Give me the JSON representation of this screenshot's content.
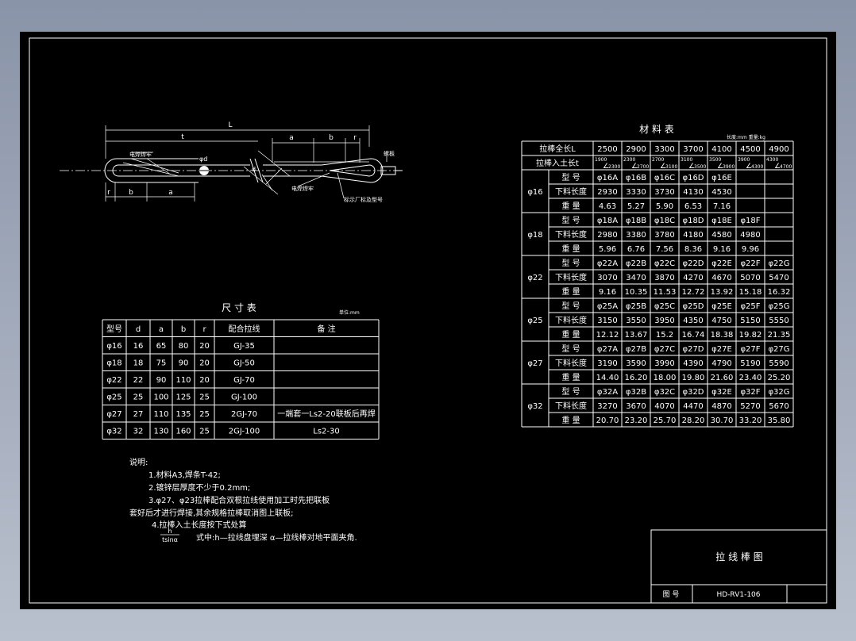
{
  "drawing": {
    "labels": {
      "L": "L",
      "t": "t",
      "a": "a",
      "b": "b",
      "r": "r",
      "weld_left": "电焊焊牢",
      "weld_right": "电焊焊牢",
      "mark": "标示厂标及型号",
      "bolt": "螺板",
      "d": "d",
      "phi": "φd"
    }
  },
  "dim_table": {
    "title": "尺 寸 表",
    "unit": "单位:mm",
    "headers": [
      "型号",
      "d",
      "a",
      "b",
      "r",
      "配合拉线",
      "备        注"
    ],
    "rows": [
      [
        "φ16",
        "16",
        "65",
        "80",
        "20",
        "GJ-35",
        ""
      ],
      [
        "φ18",
        "18",
        "75",
        "90",
        "20",
        "GJ-50",
        ""
      ],
      [
        "φ22",
        "22",
        "90",
        "110",
        "20",
        "GJ-70",
        ""
      ],
      [
        "φ25",
        "25",
        "100",
        "125",
        "25",
        "GJ-100",
        ""
      ],
      [
        "φ27",
        "27",
        "110",
        "135",
        "25",
        "2GJ-70",
        "一端套一Ls2-20联板后再焊"
      ],
      [
        "φ32",
        "32",
        "130",
        "160",
        "25",
        "2GJ-100",
        "Ls2-30"
      ]
    ]
  },
  "material_table": {
    "title": "材 料 表",
    "unit": "长度:mm   重量:kg",
    "total_length_label": "拉棒全长L",
    "total_lengths": [
      "2500",
      "2900",
      "3300",
      "3700",
      "4100",
      "4500",
      "4900"
    ],
    "buried_label": "拉棒入土长t",
    "buried": [
      {
        "top": "1900",
        "bottom": "2300"
      },
      {
        "top": "2300",
        "bottom": "2700"
      },
      {
        "top": "2700",
        "bottom": "3100"
      },
      {
        "top": "3100",
        "bottom": "3500"
      },
      {
        "top": "3500",
        "bottom": "3900"
      },
      {
        "top": "3900",
        "bottom": "4300"
      },
      {
        "top": "4300",
        "bottom": "4700"
      }
    ],
    "row_labels": [
      "型  号",
      "下料长度",
      "重  量"
    ],
    "groups": [
      {
        "name": "φ16",
        "models": [
          "φ16A",
          "φ16B",
          "φ16C",
          "φ16D",
          "φ16E",
          "",
          ""
        ],
        "lengths": [
          "2930",
          "3330",
          "3730",
          "4130",
          "4530",
          "",
          ""
        ],
        "weights": [
          "4.63",
          "5.27",
          "5.90",
          "6.53",
          "7.16",
          "",
          ""
        ]
      },
      {
        "name": "φ18",
        "models": [
          "φ18A",
          "φ18B",
          "φ18C",
          "φ18D",
          "φ18E",
          "φ18F",
          ""
        ],
        "lengths": [
          "2980",
          "3380",
          "3780",
          "4180",
          "4580",
          "4980",
          ""
        ],
        "weights": [
          "5.96",
          "6.76",
          "7.56",
          "8.36",
          "9.16",
          "9.96",
          ""
        ]
      },
      {
        "name": "φ22",
        "models": [
          "φ22A",
          "φ22B",
          "φ22C",
          "φ22D",
          "φ22E",
          "φ22F",
          "φ22G"
        ],
        "lengths": [
          "3070",
          "3470",
          "3870",
          "4270",
          "4670",
          "5070",
          "5470"
        ],
        "weights": [
          "9.16",
          "10.35",
          "11.53",
          "12.72",
          "13.92",
          "15.18",
          "16.32"
        ]
      },
      {
        "name": "φ25",
        "models": [
          "φ25A",
          "φ25B",
          "φ25C",
          "φ25D",
          "φ25E",
          "φ25F",
          "φ25G"
        ],
        "lengths": [
          "3150",
          "3550",
          "3950",
          "4350",
          "4750",
          "5150",
          "5550"
        ],
        "weights": [
          "12.12",
          "13.67",
          "15.2",
          "16.74",
          "18.38",
          "19.82",
          "21.35"
        ]
      },
      {
        "name": "φ27",
        "models": [
          "φ27A",
          "φ27B",
          "φ27C",
          "φ27D",
          "φ27E",
          "φ27F",
          "φ27G"
        ],
        "lengths": [
          "3190",
          "3590",
          "3990",
          "4390",
          "4790",
          "5190",
          "5590"
        ],
        "weights": [
          "14.40",
          "16.20",
          "18.00",
          "19.80",
          "21.60",
          "23.40",
          "25.20"
        ]
      },
      {
        "name": "φ32",
        "models": [
          "φ32A",
          "φ32B",
          "φ32C",
          "φ32D",
          "φ32E",
          "φ32F",
          "φ32G"
        ],
        "lengths": [
          "3270",
          "3670",
          "4070",
          "4470",
          "4870",
          "5270",
          "5670"
        ],
        "weights": [
          "20.70",
          "23.20",
          "25.70",
          "28.20",
          "30.70",
          "33.20",
          "35.80"
        ]
      }
    ]
  },
  "notes": {
    "heading": "说明:",
    "lines": [
      "1.材料A3,焊条T-42;",
      "2.镀锌层厚度不少于0.2mm;",
      "3.φ27、φ23拉棒配合双根拉线使用加工时先把联板",
      "套好后才进行焊接,其余规格拉棒取消图上联板;",
      "4.拉棒入土长度按下式处算"
    ],
    "formula_num": "h",
    "formula_den": "tsinα",
    "formula_text": "式中:h—拉线盘埋深  α—拉线棒对地平面夹角."
  },
  "title_block": {
    "title": "拉 线 棒 图",
    "drawing_no_label": "图  号",
    "drawing_no": "HD-RV1-106"
  }
}
